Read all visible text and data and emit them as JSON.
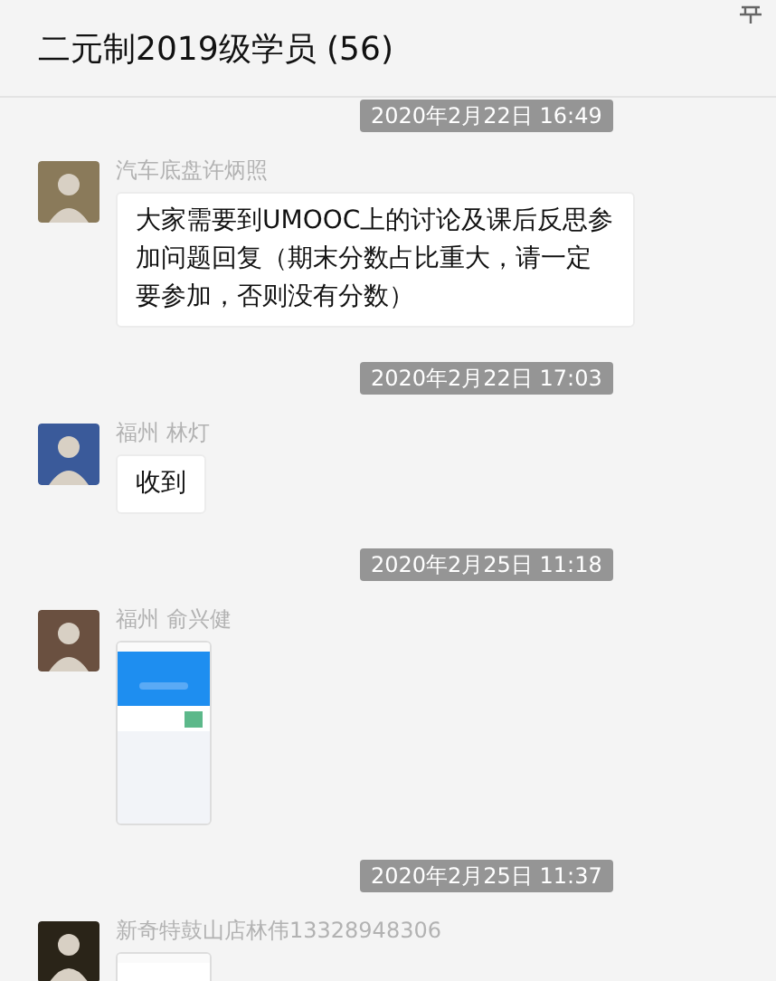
{
  "window": {
    "title": "二元制2019级学员 (56)"
  },
  "messages": [
    {
      "time": "2020年2月22日 16:49",
      "sender": "汽车底盘许炳照",
      "kind": "text",
      "text": "大家需要到UMOOC上的讨论及课后反思参加问题回复（期末分数占比重大，请一定要参加，否则没有分数）"
    },
    {
      "time": "2020年2月22日 17:03",
      "sender": "福州 林灯",
      "kind": "text",
      "text": "收到"
    },
    {
      "time": "2020年2月25日 11:18",
      "sender": "福州 俞兴健"
    },
    {
      "time": "2020年2月25日 11:37",
      "sender": "新奇特鼓山店林伟13328948306"
    }
  ]
}
